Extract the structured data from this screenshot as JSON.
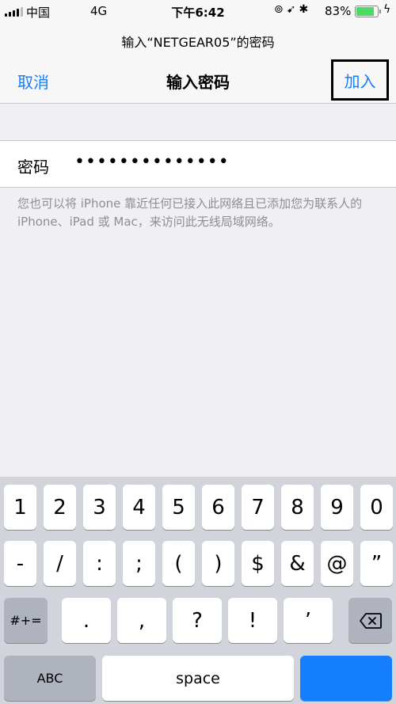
{
  "status_bar": {
    "carrier": "中国",
    "network": "4G",
    "time": "下午6:42",
    "battery_percent": "83%",
    "battery_level": 0.83
  },
  "nav": {
    "prompt": "输入“NETGEAR05”的密码",
    "cancel": "取消",
    "title": "输入密码",
    "join": "加入"
  },
  "form": {
    "password_label": "密码",
    "password_value": "••••••••••••••"
  },
  "note": "您也可以将 iPhone 靠近任何已接入此网络且已添加您为联系人的 iPhone、iPad 或 Mac，来访问此无线局域网络。",
  "keyboard": {
    "row1": [
      "1",
      "2",
      "3",
      "4",
      "5",
      "6",
      "7",
      "8",
      "9",
      "0"
    ],
    "row2": [
      "-",
      "/",
      ":",
      ";",
      "(",
      ")",
      "$",
      "&",
      "@",
      "”"
    ],
    "row3": [
      "#+=",
      ".",
      ",",
      "?",
      "!",
      "’"
    ],
    "abc": "ABC",
    "space": "space"
  }
}
